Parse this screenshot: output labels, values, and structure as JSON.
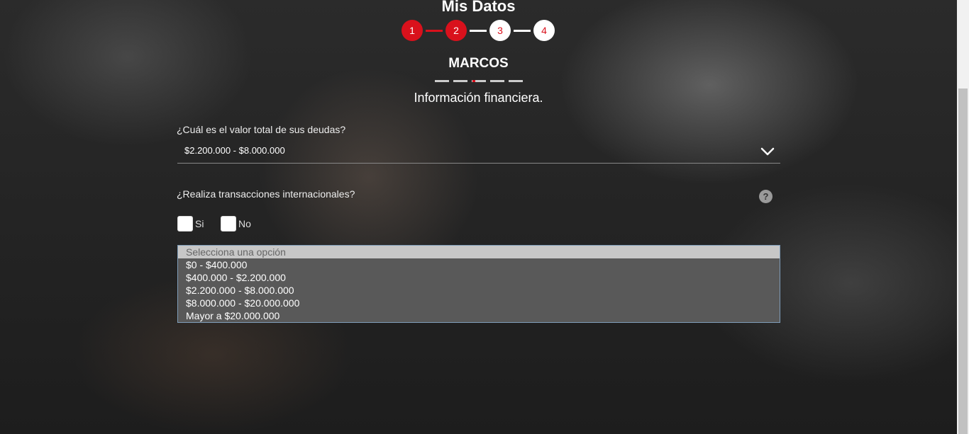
{
  "header": {
    "title": "Mis Datos"
  },
  "stepper": {
    "steps": [
      {
        "label": "1",
        "state": "done"
      },
      {
        "label": "2",
        "state": "done"
      },
      {
        "label": "3",
        "state": "todo"
      },
      {
        "label": "4",
        "state": "todo"
      }
    ],
    "colors": {
      "accent": "#d9111c",
      "inactive": "#ffffff"
    }
  },
  "user": {
    "name": "MARCOS"
  },
  "section": {
    "subtitle": "Información financiera."
  },
  "debt": {
    "question": "¿Cuál es el valor total de sus deudas?",
    "selected": "$2.200.000 - $8.000.000",
    "icon": "chevron-down-icon"
  },
  "international": {
    "question": "¿Realiza transacciones internacionales?",
    "help_icon": "?",
    "options": [
      {
        "label": "Si",
        "checked": false
      },
      {
        "label": "No",
        "checked": false
      }
    ]
  },
  "dropdown": {
    "placeholder": "Selecciona una opción",
    "options": [
      "$0 - $400.000",
      "$400.000 - $2.200.000",
      "$2.200.000 - $8.000.000",
      "$8.000.000 - $20.000.000",
      "Mayor a $20.000.000"
    ]
  }
}
